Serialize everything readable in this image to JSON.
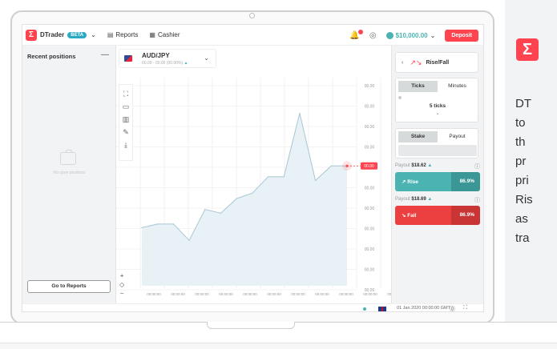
{
  "header": {
    "logo_glyph": "Σ",
    "app_name": "DTrader",
    "beta": "BETA",
    "nav": [
      {
        "label": "Reports",
        "icon": "reports-icon"
      },
      {
        "label": "Cashier",
        "icon": "cashier-icon"
      }
    ],
    "balance": "$10,000.00",
    "deposit": "Deposit"
  },
  "left_panel": {
    "title": "Recent positions",
    "empty_text": "No open positions",
    "go_to_reports": "Go to Reports"
  },
  "market": {
    "symbol": "AUD/JPY",
    "sub": "00.00 - 00.00 (00.00%)",
    "change_arrow": "▲"
  },
  "chart": {
    "price_labels": [
      "00.00",
      "00.00",
      "00.00",
      "00.00",
      "00.00",
      "00.00",
      "00.00",
      "00.00",
      "00.00",
      "00.00",
      "00.00",
      "00.00",
      "00.00"
    ],
    "current_price": "00.00",
    "time_labels": [
      "00:00:00",
      "00:00:00",
      "00:00:00",
      "00:00:00",
      "00:00:00",
      "00:00:00",
      "00:00:00",
      "00:00:00",
      "00:00:00",
      "00:00:00",
      "00:00:00"
    ]
  },
  "chart_data": {
    "type": "area",
    "x": [
      1,
      2,
      3,
      4,
      5,
      6,
      7,
      8,
      9,
      10,
      11,
      12,
      13,
      14
    ],
    "values": [
      0.32,
      0.34,
      0.34,
      0.25,
      0.42,
      0.4,
      0.48,
      0.51,
      0.6,
      0.6,
      0.95,
      0.58,
      0.66,
      0.66
    ]
  },
  "trade": {
    "trade_type": "Rise/Fall",
    "duration_tabs": [
      "Ticks",
      "Minutes"
    ],
    "duration_value": "5 ticks",
    "amount_tabs": [
      "Stake",
      "Payout"
    ],
    "rise": {
      "payout_label": "Payout",
      "payout": "$18.62",
      "label": "Rise",
      "percent": "86.9%"
    },
    "fall": {
      "payout_label": "Payout",
      "payout": "$18.69",
      "label": "Fall",
      "percent": "86.9%"
    }
  },
  "footer": {
    "datetime": "01 Jan 2020 00:00:00 GMT"
  },
  "side_panel": {
    "logo_glyph": "Σ",
    "text": "DT\nto\nth\npr\npri\nRis\nas\ntra"
  }
}
